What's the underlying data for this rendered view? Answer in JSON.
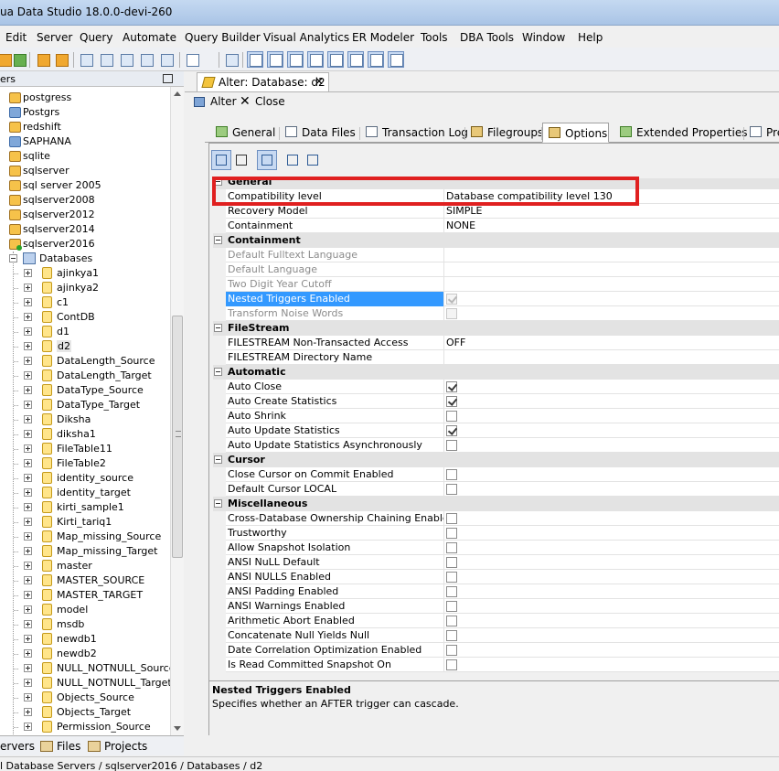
{
  "window": {
    "title": "ua Data Studio 18.0.0-devi-260"
  },
  "menu": [
    "Edit",
    "Server",
    "Query",
    "Automate",
    "Query Builder",
    "Visual Analytics",
    "ER Modeler",
    "Tools",
    "DBA Tools",
    "Window",
    "Help"
  ],
  "left_panel": {
    "header": "ers",
    "servers": [
      "postgress",
      "Postgrs",
      "redshift",
      "SAPHANA",
      "sqlite",
      "sqlserver",
      "sql server 2005",
      "sqlserver2008",
      "sqlserver2012",
      "sqlserver2014",
      "sqlserver2016"
    ],
    "databases_label": "Databases",
    "databases": [
      "ajinkya1",
      "ajinkya2",
      "c1",
      "ContDB",
      "d1",
      "d2",
      "DataLength_Source",
      "DataLength_Target",
      "DataType_Source",
      "DataType_Target",
      "Diksha",
      "diksha1",
      "FileTable11",
      "FileTable2",
      "identity_source",
      "identity_target",
      "kirti_sample1",
      "Kirti_tariq1",
      "Map_missing_Source",
      "Map_missing_Target",
      "master",
      "MASTER_SOURCE",
      "MASTER_TARGET",
      "model",
      "msdb",
      "newdb1",
      "newdb2",
      "NULL_NOTNULL_Source",
      "NULL_NOTNULL_Target",
      "Objects_Source",
      "Objects_Target",
      "Permission_Source"
    ],
    "selected_database": "d2",
    "bottom_tabs": [
      "ervers",
      "Files",
      "Projects"
    ]
  },
  "editor": {
    "tab_label": "Alter: Database: d2",
    "tab_close": "✕",
    "alter_label": "Alter",
    "close_label": "Close",
    "tabs": [
      "General",
      "Data Files",
      "Transaction Log",
      "Filegroups",
      "Options",
      "Extended Properties",
      "Pre"
    ],
    "active_tab": "Options",
    "description_title": "Nested Triggers Enabled",
    "description_text": "Specifies whether an AFTER trigger can cascade."
  },
  "options_grid": [
    {
      "type": "category",
      "label": "General"
    },
    {
      "type": "prop",
      "name": "Compatibility level",
      "value": "Database compatibility level 130"
    },
    {
      "type": "prop",
      "name": "Recovery Model",
      "value": "SIMPLE"
    },
    {
      "type": "prop",
      "name": "Containment",
      "value": "NONE"
    },
    {
      "type": "category",
      "label": "Containment"
    },
    {
      "type": "prop",
      "name": "Default Fulltext Language",
      "value": "",
      "disabled": true
    },
    {
      "type": "prop",
      "name": "Default Language",
      "value": "",
      "disabled": true
    },
    {
      "type": "prop",
      "name": "Two Digit Year Cutoff",
      "value": "",
      "disabled": true
    },
    {
      "type": "check",
      "name": "Nested Triggers Enabled",
      "checked": true,
      "disabled": true,
      "selected": true
    },
    {
      "type": "check",
      "name": "Transform Noise Words",
      "checked": false,
      "disabled": true
    },
    {
      "type": "category",
      "label": "FileStream"
    },
    {
      "type": "prop",
      "name": "FILESTREAM Non-Transacted Access",
      "value": "OFF"
    },
    {
      "type": "prop",
      "name": "FILESTREAM Directory Name",
      "value": ""
    },
    {
      "type": "category",
      "label": "Automatic"
    },
    {
      "type": "check",
      "name": "Auto Close",
      "checked": true
    },
    {
      "type": "check",
      "name": "Auto Create Statistics",
      "checked": true
    },
    {
      "type": "check",
      "name": "Auto Shrink",
      "checked": false
    },
    {
      "type": "check",
      "name": "Auto Update Statistics",
      "checked": true
    },
    {
      "type": "check",
      "name": "Auto Update Statistics Asynchronously",
      "checked": false
    },
    {
      "type": "category",
      "label": "Cursor"
    },
    {
      "type": "check",
      "name": "Close Cursor on Commit Enabled",
      "checked": false
    },
    {
      "type": "check",
      "name": "Default Cursor LOCAL",
      "checked": false
    },
    {
      "type": "category",
      "label": "Miscellaneous"
    },
    {
      "type": "check",
      "name": "Cross-Database Ownership Chaining Enabled",
      "checked": false
    },
    {
      "type": "check",
      "name": "Trustworthy",
      "checked": false
    },
    {
      "type": "check",
      "name": "Allow Snapshot Isolation",
      "checked": false
    },
    {
      "type": "check",
      "name": "ANSI NuLL Default",
      "checked": false
    },
    {
      "type": "check",
      "name": "ANSI NULLS Enabled",
      "checked": false
    },
    {
      "type": "check",
      "name": "ANSI Padding Enabled",
      "checked": false
    },
    {
      "type": "check",
      "name": "ANSI Warnings Enabled",
      "checked": false
    },
    {
      "type": "check",
      "name": "Arithmetic Abort Enabled",
      "checked": false
    },
    {
      "type": "check",
      "name": "Concatenate Null Yields Null",
      "checked": false
    },
    {
      "type": "check",
      "name": "Date Correlation Optimization Enabled",
      "checked": false
    },
    {
      "type": "check",
      "name": "Is Read Committed Snapshot On",
      "checked": false
    }
  ],
  "status": {
    "path": "l Database Servers / sqlserver2016 / Databases / d2"
  },
  "colors": {
    "highlight_box": "#e02020",
    "selection": "#3399ff"
  }
}
